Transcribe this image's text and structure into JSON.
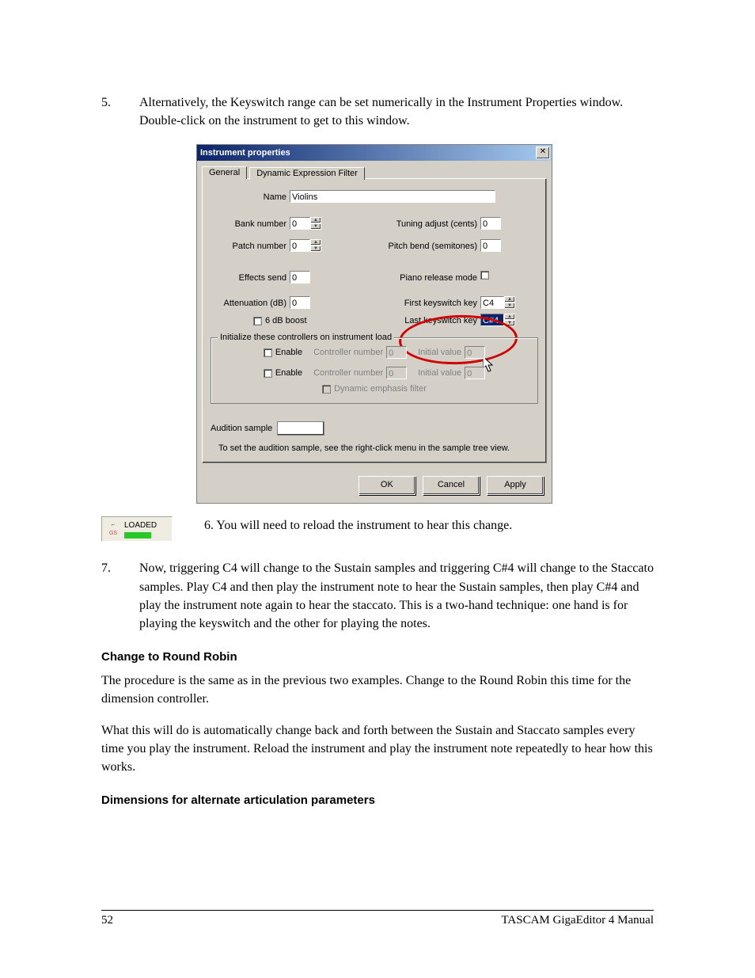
{
  "step5": {
    "num": "5.",
    "text": "Alternatively, the Keyswitch range can be set numerically in the Instrument Properties window. Double-click on the instrument to get to this window."
  },
  "dialog": {
    "title": "Instrument properties",
    "close_glyph": "✕",
    "tab_general": "General",
    "tab_def": "Dynamic Expression Filter",
    "name_lbl": "Name",
    "name_val": "Violins",
    "bank_lbl": "Bank number",
    "bank_val": "0",
    "patch_lbl": "Patch number",
    "patch_val": "0",
    "fx_lbl": "Effects send",
    "fx_val": "0",
    "att_lbl": "Attenuation (dB)",
    "att_val": "0",
    "boost_lbl": "6 dB boost",
    "tune_lbl": "Tuning adjust (cents)",
    "tune_val": "0",
    "bend_lbl": "Pitch bend (semitones)",
    "bend_val": "0",
    "piano_lbl": "Piano release mode",
    "firstks_lbl": "First keyswitch key",
    "firstks_val": "C4",
    "lastks_lbl": "Last keyswitch key",
    "lastks_val": "C#4",
    "group_legend": "Initialize these controllers on instrument load",
    "enable_lbl": "Enable",
    "ctrlnum_lbl": "Controller number",
    "ctrlnum_val": "0",
    "initval_lbl": "Initial value",
    "initval_val": "0",
    "dynemph_lbl": "Dynamic emphasis filter",
    "aud_lbl": "Audition sample",
    "aud_hint": "To set the audition sample, see the right-click menu in the sample tree view.",
    "ok": "OK",
    "cancel": "Cancel",
    "apply": "Apply"
  },
  "loaded_badge": {
    "label": "LOADED",
    "gs": "GS"
  },
  "step6": {
    "text": "6. You will need to reload the instrument to hear this change."
  },
  "step7": {
    "num": "7.",
    "text": "Now, triggering C4 will change to the Sustain samples and triggering C#4 will change to the Staccato samples.  Play C4 and then play the instrument note to hear the Sustain samples, then play C#4 and play the instrument note again to hear the staccato.  This is a two-hand technique: one hand is for playing the keyswitch and the other for playing the notes."
  },
  "heading1": "Change to Round Robin",
  "para1": "The procedure is the same as in the previous two examples. Change to the Round Robin this time for the dimension controller.",
  "para2": "What this will do is automatically change back and forth between the Sustain and Staccato samples every time you play the instrument. Reload the instrument and play the instrument note repeatedly to hear how this works.",
  "heading2": "Dimensions for alternate articulation parameters",
  "footer": {
    "page": "52",
    "book": "TASCAM GigaEditor 4 Manual"
  }
}
